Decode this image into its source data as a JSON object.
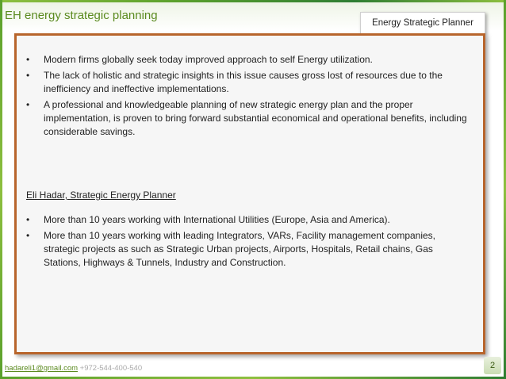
{
  "slide": {
    "title": "EH energy strategic planning",
    "badge_label": "Energy Strategic Planner",
    "page_number": "2"
  },
  "intro": {
    "bullets": [
      "Modern firms globally seek today improved approach to self Energy utilization.",
      "The lack of holistic and strategic insights in this issue causes gross lost of resources due to the inefficiency and ineffective implementations.",
      "A professional and knowledgeable planning of new strategic energy plan and the proper implementation, is proven to bring forward substantial economical and operational benefits, including considerable  savings."
    ]
  },
  "profile": {
    "heading": "Eli Hadar, Strategic Energy Planner",
    "bullets": [
      "More than 10 years working with International Utilities (Europe, Asia and America).",
      "More than 10 years working with leading Integrators, VARs, Facility management companies, strategic projects as such as Strategic Urban projects, Airports, Hospitals, Retail chains, Gas Stations, Highways & Tunnels, Industry and Construction."
    ]
  },
  "footer": {
    "email": "hadareli1@gmail.com",
    "phone": "+972-544-400-540"
  },
  "colors": {
    "title_green": "#5a8a1f",
    "panel_border": "#b8652c",
    "panel_background": "#f6f6f6",
    "band_green": "#5aa02c"
  }
}
